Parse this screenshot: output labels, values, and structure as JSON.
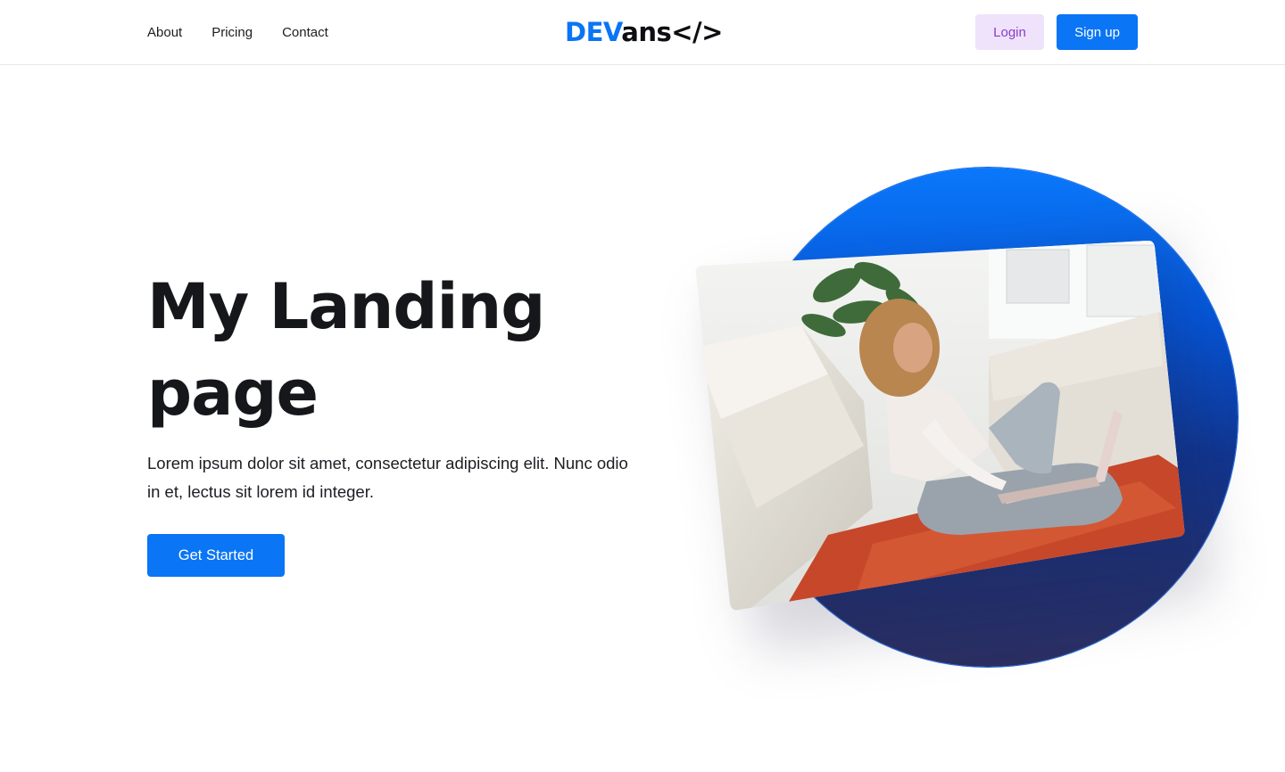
{
  "nav": {
    "items": [
      {
        "label": "About"
      },
      {
        "label": "Pricing"
      },
      {
        "label": "Contact"
      }
    ]
  },
  "logo": {
    "part1": "DEV",
    "part2": "ans</>"
  },
  "auth": {
    "login_label": "Login",
    "signup_label": "Sign up"
  },
  "hero": {
    "title_line1": "My Landing",
    "title_line2": "page",
    "text": "Lorem ipsum dolor sit amet, consectetur adipiscing elit. Nunc odio in et, lectus sit lorem id integer.",
    "cta_label": "Get Started"
  },
  "colors": {
    "accent": "#0a75f5",
    "login_bg": "#efe3fb",
    "login_text": "#8b3dc9",
    "heading": "#16171b"
  },
  "image": {
    "icon": "hero-photo-woman-laptop"
  }
}
